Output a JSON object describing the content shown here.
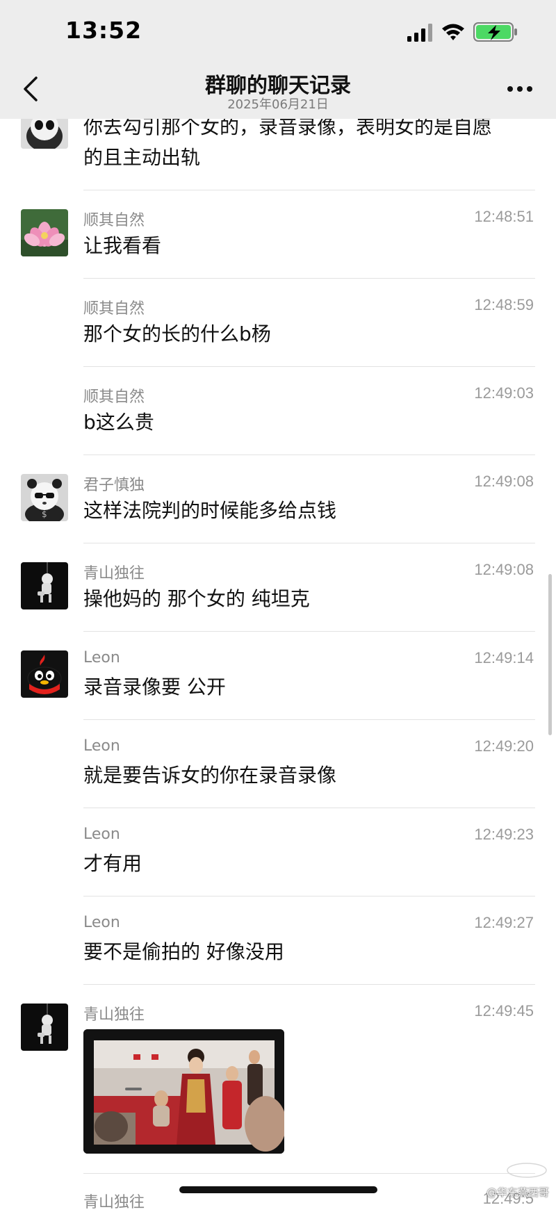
{
  "status_bar": {
    "time": "13:52",
    "icons": [
      "signal-icon",
      "wifi-icon",
      "battery-charging-icon"
    ],
    "battery_color": "#4cd964"
  },
  "nav": {
    "title": "群聊的聊天记录",
    "date": "2025年06月21日",
    "icons": [
      "back-chevron-icon",
      "more-dots-icon"
    ]
  },
  "messages": [
    {
      "avatar": "panda-avatar",
      "text_lines": [
        "你去勾引那个女的，录音录像，表明女的是自愿",
        "的且主动出轨"
      ]
    },
    {
      "name": "顺其自然",
      "time": "12:48:51",
      "avatar": "lotus-avatar",
      "text": "让我看看"
    },
    {
      "name": "顺其自然",
      "time": "12:48:59",
      "text": "那个女的长的什么b杨"
    },
    {
      "name": "顺其自然",
      "time": "12:49:03",
      "text": "b这么贵"
    },
    {
      "name": "君子慎独",
      "time": "12:49:08",
      "avatar": "panda-avatar",
      "text": "这样法院判的时候能多给点钱"
    },
    {
      "name": "青山独往",
      "time": "12:49:08",
      "avatar": "astronaut-avatar",
      "text": "操他妈的 那个女的 纯坦克"
    },
    {
      "name": "Leon",
      "time": "12:49:14",
      "avatar": "qq-penguin-avatar",
      "text": "录音录像要 公开"
    },
    {
      "name": "Leon",
      "time": "12:49:20",
      "text": "就是要告诉女的你在录音录像"
    },
    {
      "name": "Leon",
      "time": "12:49:23",
      "text": "才有用"
    },
    {
      "name": "Leon",
      "time": "12:49:27",
      "text": "要不是偷拍的 好像没用"
    },
    {
      "name": "青山独往",
      "time": "12:49:45",
      "avatar": "astronaut-avatar",
      "type": "image",
      "image_desc": "wedding-photo"
    },
    {
      "name": "青山独往",
      "time": "12:49:5"
    }
  ],
  "watermark": {
    "text": "@华东燕西哥",
    "logo_text": "微博"
  },
  "colors": {
    "topbar_bg": "#ededed",
    "name_gray": "#8a8a8a",
    "divider": "#e2e2e2"
  }
}
